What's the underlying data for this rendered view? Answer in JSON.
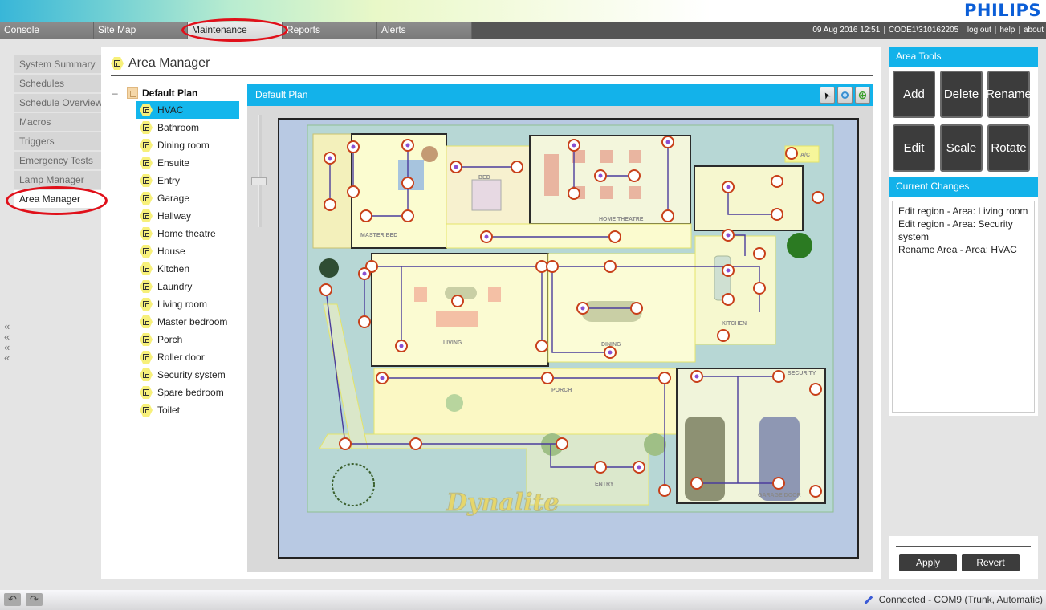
{
  "brand": "PHILIPS",
  "nav": {
    "tabs": [
      {
        "label": "Console",
        "active": false
      },
      {
        "label": "Site Map",
        "active": false
      },
      {
        "label": "Maintenance",
        "active": true
      },
      {
        "label": "Reports",
        "active": false
      },
      {
        "label": "Alerts",
        "active": false
      }
    ],
    "datetime": "09 Aug 2016 12:51",
    "user": "CODE1\\310162205",
    "logout": "log out",
    "help": "help",
    "about": "about"
  },
  "leftmenu": {
    "items": [
      {
        "label": "System Summary",
        "active": false
      },
      {
        "label": "Schedules",
        "active": false
      },
      {
        "label": "Schedule Overview",
        "active": false
      },
      {
        "label": "Macros",
        "active": false
      },
      {
        "label": "Triggers",
        "active": false
      },
      {
        "label": "Emergency Tests",
        "active": false
      },
      {
        "label": "Lamp Manager",
        "active": false
      },
      {
        "label": "Area Manager",
        "active": true
      }
    ],
    "collapse_glyph": "«"
  },
  "page": {
    "title": "Area Manager"
  },
  "tree": {
    "root": "Default Plan",
    "items": [
      {
        "label": "HVAC",
        "selected": true
      },
      {
        "label": "Bathroom"
      },
      {
        "label": "Dining room"
      },
      {
        "label": "Ensuite"
      },
      {
        "label": "Entry"
      },
      {
        "label": "Garage"
      },
      {
        "label": "Hallway"
      },
      {
        "label": "Home theatre"
      },
      {
        "label": "House"
      },
      {
        "label": "Kitchen"
      },
      {
        "label": "Laundry"
      },
      {
        "label": "Living room"
      },
      {
        "label": "Master bedroom"
      },
      {
        "label": "Porch"
      },
      {
        "label": "Roller door"
      },
      {
        "label": "Security system"
      },
      {
        "label": "Spare bedroom"
      },
      {
        "label": "Toilet"
      }
    ]
  },
  "plan": {
    "title": "Default Plan",
    "tools": [
      {
        "name": "pointer-tool",
        "glyph": "➤"
      },
      {
        "name": "zoom-tool",
        "glyph": "🔍"
      },
      {
        "name": "pan-tool",
        "glyph": "⊕"
      }
    ],
    "room_labels": {
      "master_bed": "MASTER BED",
      "bed": "BED",
      "home_theatre": "HOME THEATRE",
      "ac": "A/C",
      "living": "LIVING",
      "dining": "DINING",
      "kitchen": "KITCHEN",
      "porch": "PORCH",
      "security": "SECURITY",
      "entry": "ENTRY",
      "garage_door": "GARAGE DOOR"
    },
    "watermark": "Dynalite"
  },
  "area_tools": {
    "header": "Area Tools",
    "buttons": [
      "Add",
      "Delete",
      "Rename",
      "Edit",
      "Scale",
      "Rotate"
    ]
  },
  "current_changes": {
    "header": "Current Changes",
    "items": [
      "Edit region - Area: Living room",
      "Edit region - Area: Security system",
      "Rename Area - Area: HVAC"
    ]
  },
  "footer_buttons": {
    "apply": "Apply",
    "revert": "Revert"
  },
  "status": {
    "connection": "Connected - COM9 (Trunk, Automatic)",
    "back_glyph": "↶",
    "forward_glyph": "↷"
  },
  "colors": {
    "accent": "#13b2ea",
    "brand": "#0b5ed7",
    "highlight_ellipse": "#e0101a",
    "dark_button": "#3c3c3c"
  }
}
